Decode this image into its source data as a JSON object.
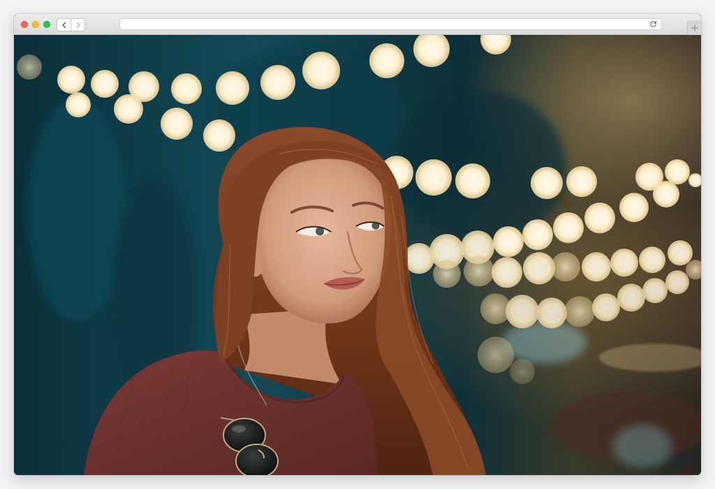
{
  "browser": {
    "url": "",
    "traffic_lights": {
      "close": "#fe5f57",
      "minimize": "#febc2e",
      "maximize": "#28c840"
    },
    "icons": {
      "back": "chevron-left-icon",
      "forward": "chevron-right-icon",
      "reload": "reload-icon",
      "new_tab": "plus-icon"
    }
  },
  "content": {
    "type": "photo",
    "palette": {
      "background_teal": "#0f3a45",
      "bokeh_warm": "#fff3d6",
      "hair": "#7a3d1f",
      "sweater": "#6e3430"
    }
  }
}
